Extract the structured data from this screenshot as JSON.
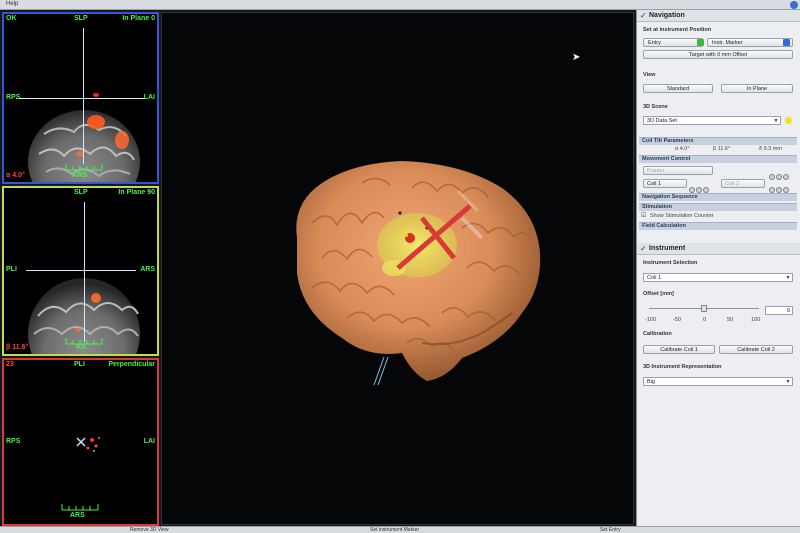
{
  "menubar": {
    "help": "Help"
  },
  "views2d": {
    "top": {
      "corner": "OK",
      "top_label": "SLP",
      "plane": "In Plane 0",
      "left": "RPS",
      "right": "LAI",
      "bottom": "ARS",
      "angle": "α 4.0°"
    },
    "mid": {
      "top_label": "SLP",
      "plane": "In Plane 90",
      "left": "PLI",
      "right": "ARS",
      "bottom": "RA",
      "angle": "β 11.6°"
    },
    "bot": {
      "corner": "23",
      "top_label": "PLI",
      "plane": "Perpendicular",
      "left": "RPS",
      "right": "LAI",
      "bottom": "ARS"
    }
  },
  "navigation": {
    "title": "Navigation",
    "set_position_label": "Set at instrument Position",
    "entry_btn": "Entry",
    "instr_marker_btn": "Instr. Marker",
    "target_btn": "Target with 0 mm Offset",
    "view_label": "View",
    "standard_btn": "Standard",
    "inplane_btn": "In Plane",
    "scene_label": "3D Scene",
    "scene_value": "3D Data Set",
    "coil_tilt_header": "Coil Tilt Parameters",
    "alpha": "α 4.0°",
    "beta": "β 11.6°",
    "delta": "δ 9.3 mm",
    "movement_header": "Movement Control",
    "pointer": "Pointer",
    "coil1": "Coil 1",
    "coil2": "Coil 2",
    "nav_seq_header": "Navigation Sequence",
    "stimulation_header": "Stimulation",
    "show_counter": "Show Stimulation Counter",
    "field_calc_header": "Field Calculation"
  },
  "instrument": {
    "title": "Instrument",
    "selection_label": "Instrument Selection",
    "selection_value": "Coil 1",
    "offset_label": "Offset [mm]",
    "offset_value": "0",
    "offset_level": 0.5,
    "ticks": [
      "-100",
      "-50",
      "0",
      "50",
      "100"
    ],
    "calibration_label": "Calibration",
    "calibrate1": "Calibrate Coil 1",
    "calibrate2": "Calibrate Coil 2",
    "repr_label": "3D Instrument Representation",
    "repr_value": "Big"
  },
  "taskbar": {
    "item1": "Remove 3D View",
    "item2": "Set instrument Marker",
    "item3": "Set Entry"
  },
  "colors": {
    "view_top_border": "#2e59d9",
    "view_mid_border": "#c7d84a",
    "view_bot_border": "#d83a3a",
    "overlay_green": "#4cf04c",
    "brain_surface": "#d98c58"
  }
}
